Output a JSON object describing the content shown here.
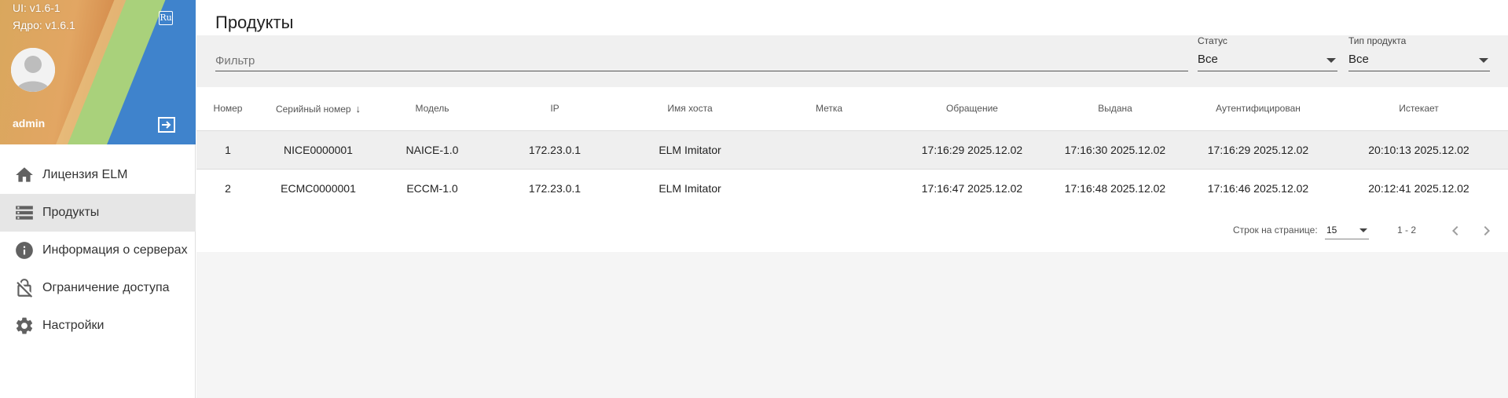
{
  "sidebar": {
    "ui_version": "UI: v1.6-1",
    "core_version": "Ядро: v1.6.1",
    "lang": "Ru",
    "username": "admin",
    "items": [
      {
        "label": "Лицензия ELM",
        "icon": "home-icon"
      },
      {
        "label": "Продукты",
        "icon": "storage-icon"
      },
      {
        "label": "Информация о серверах",
        "icon": "info-icon"
      },
      {
        "label": "Ограничение доступа",
        "icon": "lock-off-icon"
      },
      {
        "label": "Настройки",
        "icon": "gear-icon"
      }
    ]
  },
  "main": {
    "title": "Продукты",
    "filter": {
      "placeholder": "Фильтр",
      "value": ""
    },
    "status": {
      "label": "Статус",
      "value": "Все"
    },
    "product_type": {
      "label": "Тип продукта",
      "value": "Все"
    },
    "table": {
      "columns": [
        "Номер",
        "Серийный номер",
        "Модель",
        "IP",
        "Имя хоста",
        "Метка",
        "Обращение",
        "Выдана",
        "Аутентифицирован",
        "Истекает"
      ],
      "rows": [
        [
          "1",
          "NICE0000001",
          "NAICE-1.0",
          "172.23.0.1",
          "ELM Imitator",
          "",
          "17:16:29 2025.12.02",
          "17:16:30 2025.12.02",
          "17:16:29 2025.12.02",
          "20:10:13 2025.12.02"
        ],
        [
          "2",
          "ECMC0000001",
          "ECCM-1.0",
          "172.23.0.1",
          "ELM Imitator",
          "",
          "17:16:47 2025.12.02",
          "17:16:48 2025.12.02",
          "17:16:46 2025.12.02",
          "20:12:41 2025.12.02"
        ]
      ]
    },
    "pagination": {
      "rows_label": "Строк на странице:",
      "rows_value": "15",
      "range": "1 - 2"
    }
  },
  "colors": {
    "active_nav_bg": "#e6e6e6",
    "icon_gray": "#616161",
    "banner_blue": "#3f83cc",
    "banner_green": "#a9d17b",
    "banner_orange": "#e2a663"
  }
}
